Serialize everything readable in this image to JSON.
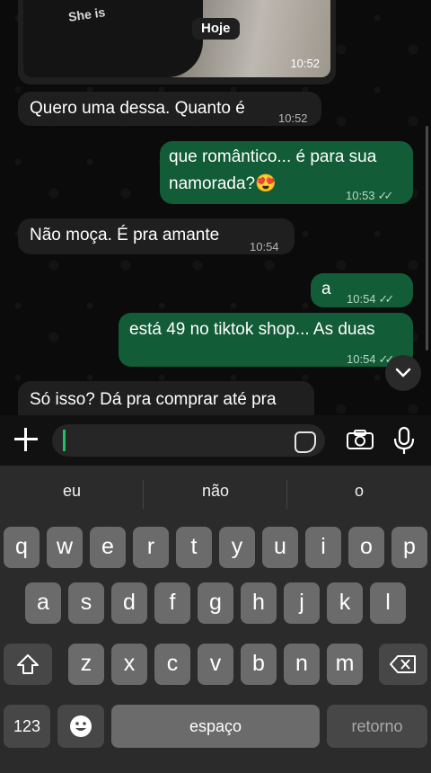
{
  "chat": {
    "image_msg": {
      "shirt_text": "She is ",
      "time": "10:52"
    },
    "date_label": "Hoje",
    "messages": [
      {
        "text": "Quero uma dessa. Quanto é",
        "time": "10:52",
        "dir": "in"
      },
      {
        "text1": "que romântico... é para sua",
        "text2": "namorada?😍",
        "time": "10:53",
        "dir": "out"
      },
      {
        "text": "Não moça. É pra amante",
        "time": "10:54",
        "dir": "in"
      },
      {
        "text": "a",
        "time": "10:54",
        "dir": "out"
      },
      {
        "text": "está 49 no tiktok shop... As duas",
        "time": "10:54",
        "dir": "out"
      },
      {
        "text": "Só isso? Dá pra comprar até pra",
        "dir": "in"
      }
    ]
  },
  "input": {
    "value": "",
    "placeholder": ""
  },
  "keyboard": {
    "suggestions": [
      "eu",
      "não",
      "o"
    ],
    "row1": [
      "q",
      "w",
      "e",
      "r",
      "t",
      "y",
      "u",
      "i",
      "o",
      "p"
    ],
    "row2": [
      "a",
      "s",
      "d",
      "f",
      "g",
      "h",
      "j",
      "k",
      "l"
    ],
    "row3": [
      "z",
      "x",
      "c",
      "v",
      "b",
      "n",
      "m"
    ],
    "numbers_label": "123",
    "space_label": "espaço",
    "return_label": "retorno"
  },
  "colors": {
    "outgoing": "#125c37",
    "incoming": "#1f1f1f",
    "accent": "#21c063"
  }
}
